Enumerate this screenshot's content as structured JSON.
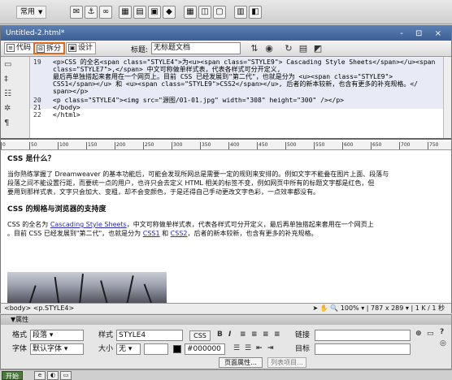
{
  "toolbar": {
    "category": "常用",
    "icons": [
      "email-link-icon",
      "anchor-icon",
      "hyperlink-icon",
      "table-icon",
      "layer-icon",
      "image-icon",
      "media-icon",
      "date-icon",
      "server-icon",
      "comment-icon",
      "template-icon",
      "tag-chooser-icon"
    ]
  },
  "window": {
    "title": "Untitled-2.html*",
    "controls": "- ⊡ ×"
  },
  "doc_toolbar": {
    "code_label": "代码",
    "split_label": "拆分",
    "design_label": "设计",
    "title_label": "标题:",
    "title_value": "无标题文档"
  },
  "code": {
    "lines": [
      {
        "num": "19",
        "text": "<p>CSS 的全名<span class=\"STYLE4\">为<u><span class=\"STYLE9\"> Cascading Style Sheets</span></u><span"
      },
      {
        "num": "",
        "text": "class=\"STYLE7\">,</span> 中文可称做单样式表，代表各样式可分开定义,"
      },
      {
        "num": "",
        "text": "最后再单独搭起来套用在一个网页上。目前 CSS 已经发展到\"第二代\"，也就是分为 <u><span class=\"STYLE9\">"
      },
      {
        "num": "",
        "text": "CSS1</span></u> 和 <u><span class=\"STYLE9\">CSS2</span></u>, 后者的新本较新，也含有更多的补充规格。</"
      },
      {
        "num": "",
        "text": "span></p>"
      },
      {
        "num": "20",
        "text": "<p class=\"STYLE4\"><img src=\"源图/01-01.jpg\" width=\"308\" height=\"300\" /></p>"
      },
      {
        "num": "21",
        "text": "</body>"
      },
      {
        "num": "22",
        "text": "</html>"
      }
    ]
  },
  "ruler": [
    "0",
    "50",
    "100",
    "150",
    "200",
    "250",
    "300",
    "350",
    "400",
    "450",
    "500",
    "550",
    "600",
    "650",
    "700",
    "750"
  ],
  "design": {
    "heading1": "CSS 是什么？",
    "para1_line1": "当你熟练掌握了 Dreamweaver 的基本功能后，可能会发现所网总是需要一定的规则来安排的。例如文字不能叠在图片上面、段落与",
    "para1_line2": "段落之间不能设置行距，而要统一点的用户，也许只会去定义 HTML 相关的标签不变，例如网页中所有的标题文字都是红色，但",
    "para1_line3": "要用到那样式表，文字只会加大、变粗，却不会变颜色，于是还得自己手动更改文字色彩，一点效率都没有。",
    "heading2": "CSS 的规格与浏览器的支持度",
    "para2_line1_a": "CSS 的全名为 ",
    "para2_link1": "Cascading Style Sheets",
    "para2_line1_b": "，中文可称做单样式表，代表各样式可分开定义，最后再单独搭起来套用在一个网页上",
    "para2_line2_a": "。目前 CSS 已经发展到\"第二代\"，也就是分为 ",
    "para2_link2": "CSS1",
    "para2_line2_b": " 和 ",
    "para2_link3": "CSS2",
    "para2_line2_c": "，后者的新本较新，也含有更多的补充规格。"
  },
  "status": {
    "tag_selector": "<body> <p.STYLE4>",
    "zoom": "100%",
    "size": "787 x 289",
    "download": "1 K / 1 秒"
  },
  "properties": {
    "title": "▼属性",
    "format_label": "格式",
    "format_value": "段落",
    "style_label": "样式",
    "style_value": "STYLE4",
    "css_label": "CSS",
    "font_label": "字体",
    "font_value": "默认字体",
    "size_label": "大小",
    "size_value": "无",
    "color_value": "#000000",
    "link_label": "链接",
    "target_label": "目标",
    "bold": "B",
    "italic": "I",
    "page_props": "页面属性...",
    "list_item": "列表项目..."
  },
  "taskbar": {
    "start": "开始"
  }
}
